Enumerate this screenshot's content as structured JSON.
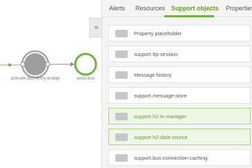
{
  "tabs": [
    {
      "label": "Alerts",
      "active": false
    },
    {
      "label": "Resources",
      "active": false
    },
    {
      "label": "Support objects",
      "active": true
    },
    {
      "label": "Properties",
      "active": false
    }
  ],
  "panel": {
    "collapse_icon": "»"
  },
  "flow": {
    "nodes": [
      {
        "label": "activate.bus-entry-bridge"
      },
      {
        "label": "send.bus"
      }
    ]
  },
  "support_objects": [
    {
      "label": "Property placeholder",
      "selected": false
    },
    {
      "label": "support.ftp-session",
      "selected": false
    },
    {
      "label": "Message history",
      "selected": false
    },
    {
      "label": "support.message-store",
      "selected": false
    },
    {
      "label": "support.h2-tx-manager",
      "selected": true
    },
    {
      "label": "support.h2-data-source",
      "selected": true
    },
    {
      "label": "support.bus-connection-caching",
      "selected": false
    }
  ],
  "colors": {
    "accent": "#6db33f",
    "selected_bg": "#eef7e6",
    "node_gray": "#9e9e9e"
  }
}
